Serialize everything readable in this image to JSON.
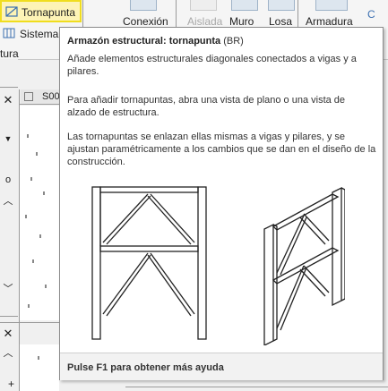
{
  "ribbon": {
    "tornapunta_label": "Tornapunta",
    "sistema_label": "Sistema",
    "estructura_label": "tura",
    "conexion_label": "Conexión",
    "aislada_label": "Aislada",
    "muro_label": "Muro",
    "losa_label": "Losa",
    "armadura_label": "Armadura",
    "extra_label": "C"
  },
  "view": {
    "tab_label": "S00",
    "plus_label": "+"
  },
  "tooltip": {
    "title": "Armazón estructural: tornapunta",
    "shortcut": "(BR)",
    "summary": "Añade elementos estructurales diagonales conectados a vigas y a pilares.",
    "paragraph1": "Para añadir tornapuntas, abra una vista de plano o una vista de alzado de estructura.",
    "paragraph2": "Las tornapuntas se enlazan ellas mismas a vigas y pilares, y se ajustan paramétricamente a los cambios que se dan en el diseño de la construcción.",
    "footer": "Pulse F1 para obtener más ayuda"
  },
  "colors": {
    "highlight": "#fdf3b6",
    "highlight_border": "#f0dd1e"
  },
  "icons": [
    "brace-icon",
    "system-icon",
    "connection-icon",
    "isolated-footing-icon",
    "wall-icon",
    "slab-icon",
    "truss-icon",
    "chevron-down-icon",
    "close-icon",
    "chevron-up-icon",
    "view-tab-icon"
  ]
}
